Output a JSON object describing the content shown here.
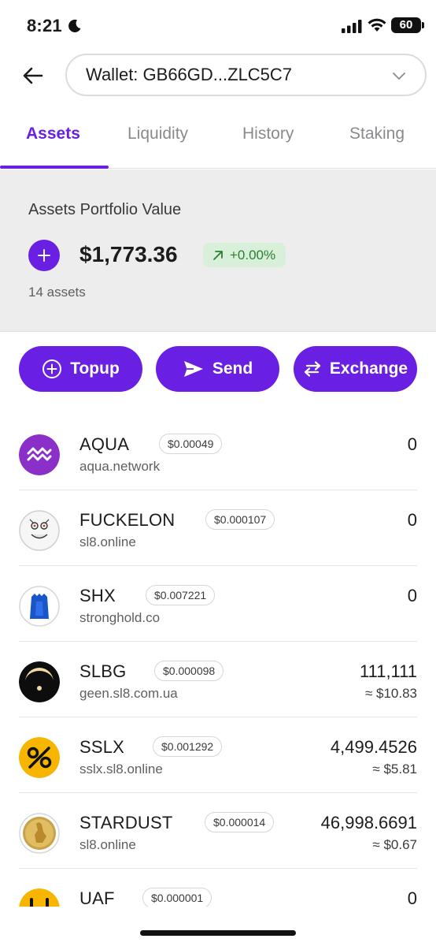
{
  "status_bar": {
    "time": "8:21",
    "battery": "60"
  },
  "header": {
    "wallet_label": "Wallet: GB66GD...ZLC5C7"
  },
  "tabs": [
    {
      "label": "Assets",
      "active": true
    },
    {
      "label": "Liquidity",
      "active": false
    },
    {
      "label": "History",
      "active": false
    },
    {
      "label": "Staking",
      "active": false
    }
  ],
  "portfolio": {
    "title": "Assets Portfolio Value",
    "value": "$1,773.36",
    "change": "+0.00%",
    "asset_count": "14 assets"
  },
  "actions": {
    "topup": "Topup",
    "send": "Send",
    "exchange": "Exchange"
  },
  "assets": [
    {
      "symbol": "AQUA",
      "price": "$0.00049",
      "domain": "aqua.network",
      "balance": "0",
      "usd": "",
      "icon": "aqua-logo"
    },
    {
      "symbol": "FUCKELON",
      "price": "$0.000107",
      "domain": "sl8.online",
      "balance": "0",
      "usd": "",
      "icon": "meme-face-logo"
    },
    {
      "symbol": "SHX",
      "price": "$0.007221",
      "domain": "stronghold.co",
      "balance": "0",
      "usd": "",
      "icon": "stronghold-logo"
    },
    {
      "symbol": "SLBG",
      "price": "$0.000098",
      "domain": "geen.sl8.com.ua",
      "balance": "111,111",
      "usd": "≈ $10.83",
      "icon": "eclipse-logo"
    },
    {
      "symbol": "SSLX",
      "price": "$0.001292",
      "domain": "sslx.sl8.online",
      "balance": "4,499.4526",
      "usd": "≈ $5.81",
      "icon": "percent-logo"
    },
    {
      "symbol": "STARDUST",
      "price": "$0.000014",
      "domain": "sl8.online",
      "balance": "46,998.6691",
      "usd": "≈ $0.67",
      "icon": "gold-coin-logo"
    },
    {
      "symbol": "UAF",
      "price": "$0.000001",
      "domain": "",
      "balance": "0",
      "usd": "",
      "icon": "uaf-logo"
    }
  ],
  "colors": {
    "accent": "#6a20e3",
    "positive_bg": "#d8f0d9",
    "positive_text": "#2e7d32",
    "panel_bg": "#ededed"
  }
}
